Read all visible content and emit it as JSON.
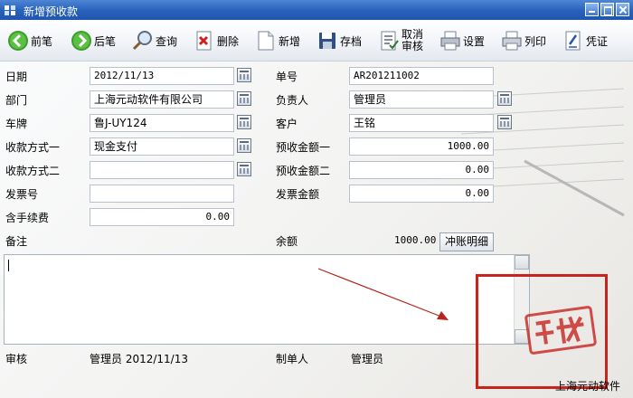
{
  "window": {
    "title": "新增预收款"
  },
  "toolbar": {
    "prev": "前笔",
    "next": "后笔",
    "query": "查询",
    "delete": "删除",
    "new": "新增",
    "save": "存档",
    "cancel_audit_line1": "取消",
    "cancel_audit_line2": "审核",
    "settings": "设置",
    "print": "列印",
    "voucher": "凭证"
  },
  "form": {
    "date_label": "日期",
    "date_value": "2012/11/13",
    "order_no_label": "单号",
    "order_no_value": "AR201211002",
    "dept_label": "部门",
    "dept_value": "上海元动软件有限公司",
    "manager_label": "负责人",
    "manager_value": "管理员",
    "plate_label": "车牌",
    "plate_value": "鲁J-UY124",
    "customer_label": "客户",
    "customer_value": "王铭",
    "pay_method1_label": "收款方式一",
    "pay_method1_value": "现金支付",
    "prepay1_label": "预收金额一",
    "prepay1_value": "1000.00",
    "pay_method2_label": "收款方式二",
    "pay_method2_value": "",
    "prepay2_label": "预收金额二",
    "prepay2_value": "0.00",
    "invoice_no_label": "发票号",
    "invoice_no_value": "",
    "invoice_amount_label": "发票金额",
    "invoice_amount_value": "0.00",
    "fee_label": "含手续费",
    "fee_value": "0.00",
    "memo_label": "备注",
    "balance_label": "余额",
    "balance_value": "1000.00",
    "offset_detail_button": "冲账明细"
  },
  "footer": {
    "audit_label": "审核",
    "audit_value": "管理员 2012/11/13",
    "creator_label": "制单人",
    "creator_value": "管理员",
    "brand": "上海元动软件"
  },
  "colors": {
    "title_bar": "#2a63bd",
    "highlight_box": "#c8231d"
  }
}
